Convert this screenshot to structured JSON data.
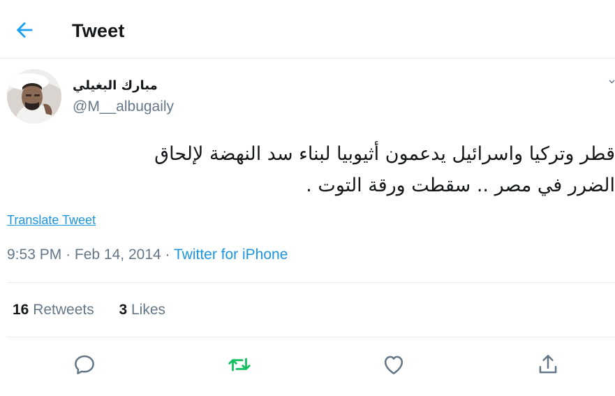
{
  "header": {
    "back_icon": "arrow-left-icon",
    "title": "Tweet"
  },
  "tweet": {
    "author": {
      "display_name": "مبارك البغيلي",
      "handle": "@M__albugaily"
    },
    "text_lines": [
      "قطر وتركيا واسرائيل يدعمون أثيوبيا لبناء سد النهضة لإلحاق",
      "الضرر في مصر .. سقطت ورقة التوت ."
    ],
    "translate_label": "Translate Tweet",
    "time": "9:53 PM",
    "date": "Feb 14, 2014",
    "separator": "·",
    "source": "Twitter for iPhone",
    "stats": {
      "retweets_count": "16",
      "retweets_label": "Retweets",
      "likes_count": "3",
      "likes_label": "Likes"
    },
    "actions": [
      "reply-icon",
      "retweet-icon",
      "like-icon",
      "share-icon"
    ]
  },
  "colors": {
    "accent": "#1da1f2",
    "link": "#1b95e0",
    "retweet_active": "#17bf63",
    "muted": "#657786",
    "divider": "#e6ecf0",
    "text": "#14171a"
  }
}
